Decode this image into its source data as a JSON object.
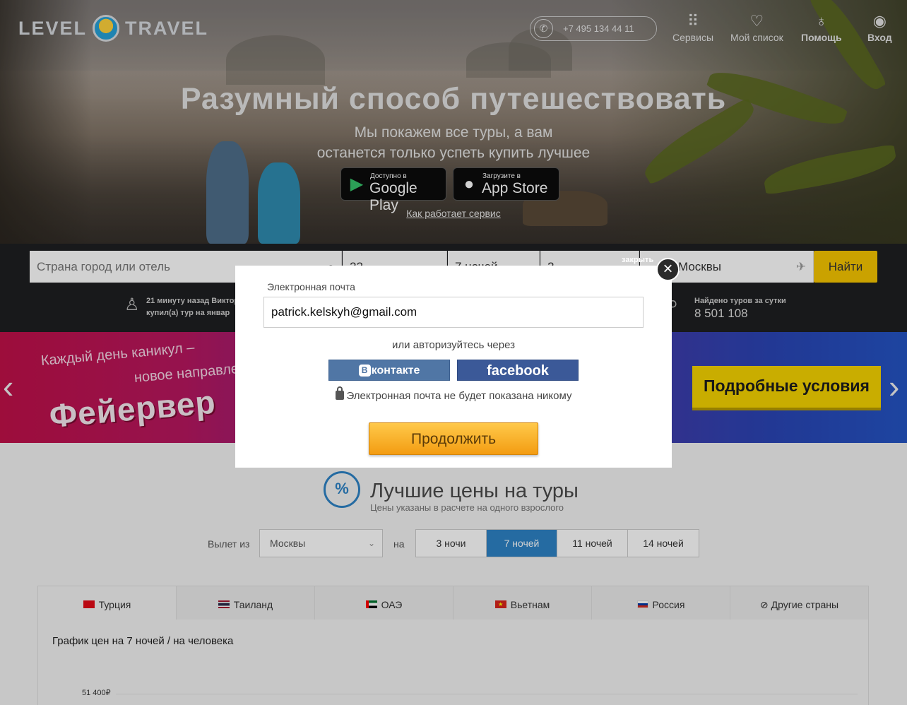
{
  "header": {
    "logo_left": "LEVEL",
    "logo_right": "TRAVEL",
    "phone": "+7 495 134 44 11",
    "nav": [
      {
        "label": "Сервисы",
        "icon": "grid-icon"
      },
      {
        "label": "Мой список",
        "icon": "heart-icon"
      },
      {
        "label": "Помощь",
        "icon": "lightbulb-icon"
      },
      {
        "label": "Вход",
        "icon": "user-icon"
      }
    ]
  },
  "hero": {
    "title": "Разумный способ путешествовать",
    "subtitle_line1": "Мы покажем все туры, а вам",
    "subtitle_line2": "останется только успеть купить лучшее",
    "google_play_small": "Доступно в",
    "google_play_big": "Google Play",
    "app_store_small": "Загрузите в",
    "app_store_big": "App Store",
    "how_link": "Как работает сервис"
  },
  "search": {
    "destination_placeholder": "Страна город или отель",
    "date_value": "22",
    "nights_value": "7 ночей",
    "travelers_value": "2",
    "departure_value": "Москвы",
    "find_label": "Найти",
    "recent_line1": "21 минуту назад Виктор",
    "recent_line2": "купил(а) тур на январ",
    "found_label": "Найдено туров за сутки",
    "found_count": "8 501 108"
  },
  "promo": {
    "line1": "Каждый день каникул –",
    "line2": "новое направле",
    "headline": "Фейервер",
    "details_label": "Подробные условия"
  },
  "best_prices": {
    "title": "Лучшие цены на туры",
    "subtitle": "Цены указаны в расчете на одного взрослого",
    "departure_label": "Вылет из",
    "departure_value": "Москвы",
    "to_label": "на",
    "nights": [
      "3 ночи",
      "7 ночей",
      "11 ночей",
      "14 ночей"
    ],
    "active_nights": 1,
    "countries": [
      "Турция",
      "Таиланд",
      "ОАЭ",
      "Вьетнам",
      "Россия",
      "Другие страны"
    ],
    "active_country": 0,
    "chart_title": "График цен на 7 ночей / на человека",
    "first_tick": "51 400₽"
  },
  "modal": {
    "email_label": "Электронная почта",
    "email_value": "patrick.kelskyh@gmail.com",
    "or_text": "или авторизуйтесь через",
    "vk_label": "контакте",
    "vk_badge": "В",
    "fb_label": "facebook",
    "privacy_note": "Электронная почта не будет показана никому",
    "continue_label": "Продолжить",
    "close_label": "закрыть"
  },
  "colors": {
    "accent_blue": "#2e83c6",
    "find_yellow": "#f7c600",
    "continue_orange": "#f39c12",
    "vk_blue": "#5076a5",
    "fb_blue": "#3b5998"
  }
}
